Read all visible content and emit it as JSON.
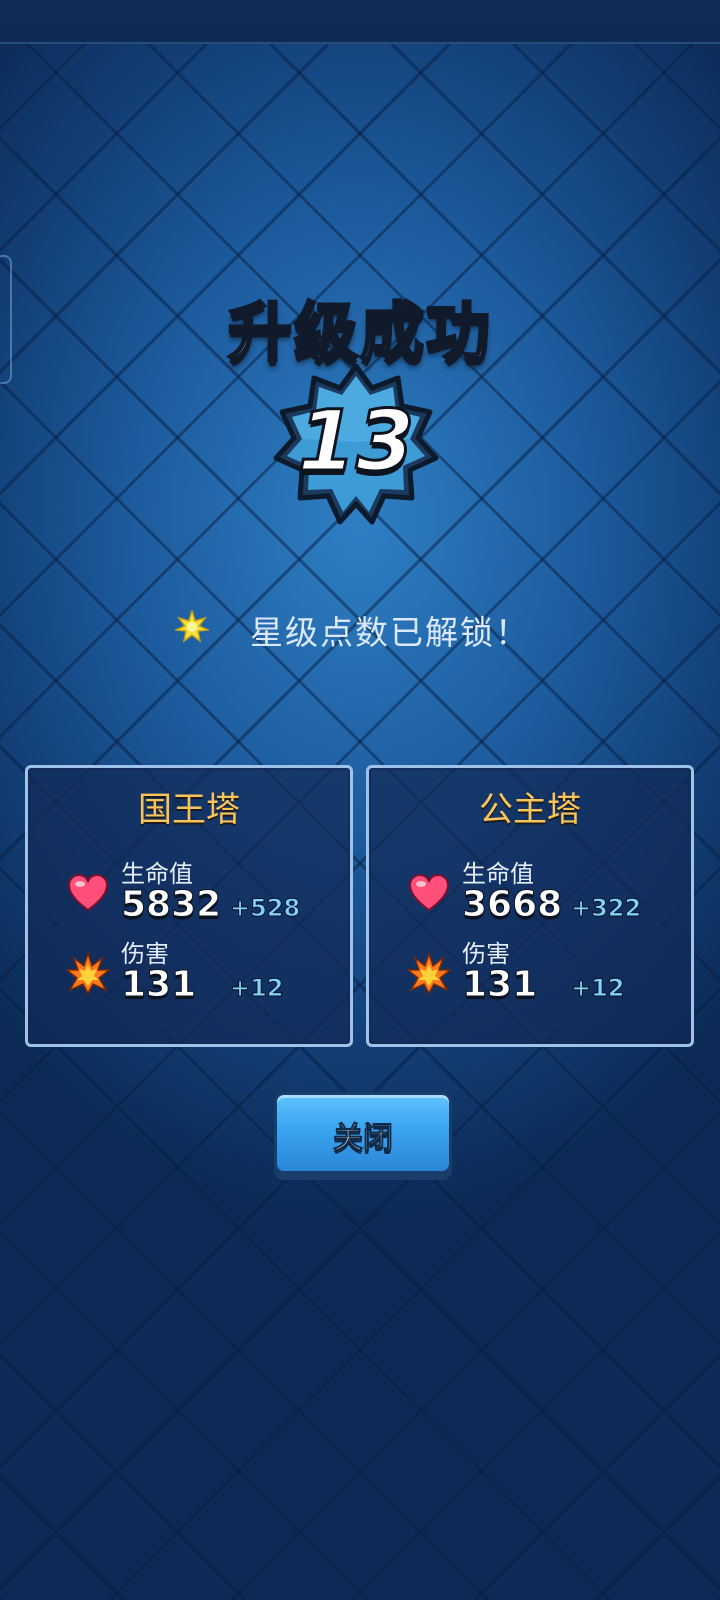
{
  "header": {
    "title": "升级成功"
  },
  "level_badge": {
    "value": "13"
  },
  "unlock": {
    "message": "星级点数已解锁！"
  },
  "towers": [
    {
      "name": "国王塔",
      "hp_label": "生命值",
      "hp_value": "5832",
      "hp_bonus": "+528",
      "damage_label": "伤害",
      "damage_value": "131",
      "damage_bonus": "+12"
    },
    {
      "name": "公主塔",
      "hp_label": "生命值",
      "hp_value": "3668",
      "hp_bonus": "+322",
      "damage_label": "伤害",
      "damage_value": "131",
      "damage_bonus": "+12"
    }
  ],
  "actions": {
    "close_label": "关闭"
  },
  "colors": {
    "panel_title": "#f9c55a",
    "bonus": "#7fd2ff",
    "button": "#3aa4f0",
    "badge": "#3d9bd6"
  }
}
